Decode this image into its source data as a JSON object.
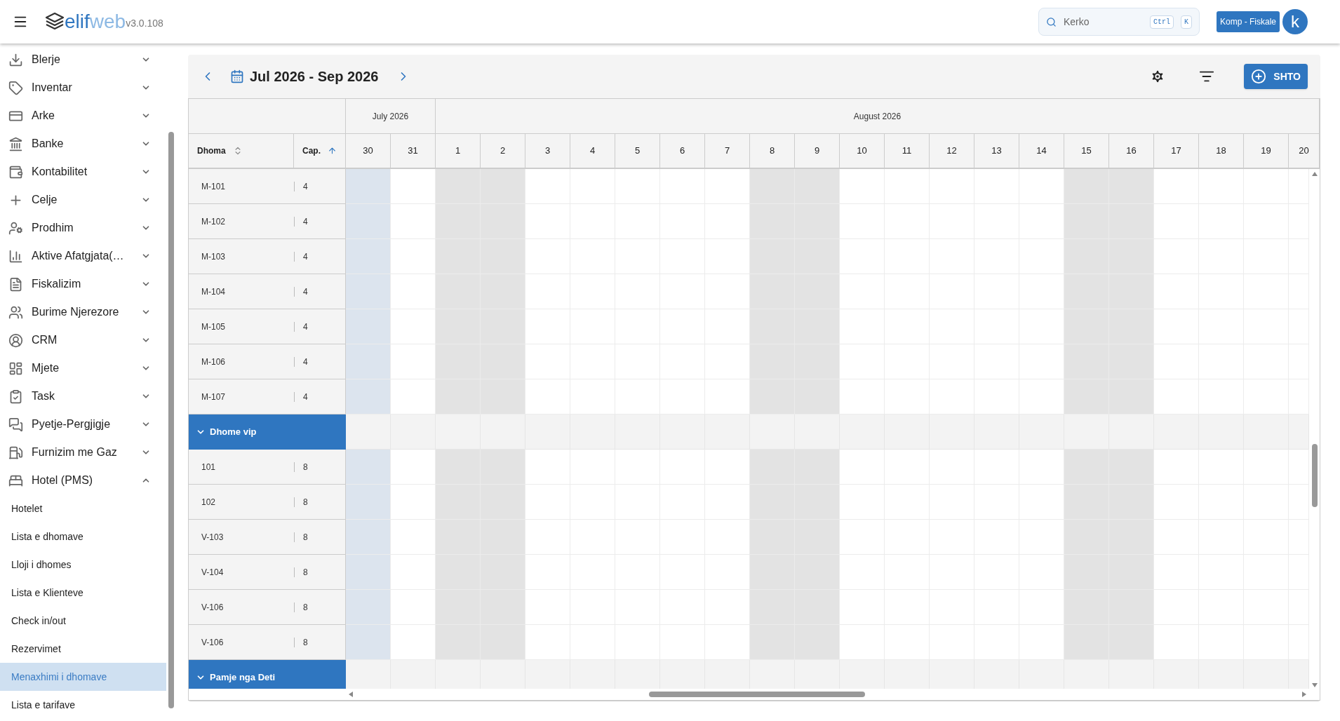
{
  "header": {
    "logo_strong": "elif",
    "logo_light": "web",
    "version": "v3.0.108",
    "search": {
      "placeholder": "Kerko",
      "keys": [
        "Ctrl",
        "K"
      ]
    },
    "company": "Komp - Fiskale",
    "avatar": "k"
  },
  "sidebar": {
    "items": [
      {
        "label": "Blerje",
        "expanded": false
      },
      {
        "label": "Inventar",
        "expanded": false
      },
      {
        "label": "Arke",
        "expanded": false
      },
      {
        "label": "Banke",
        "expanded": false
      },
      {
        "label": "Kontabilitet",
        "expanded": false
      },
      {
        "label": "Celje",
        "expanded": false
      },
      {
        "label": "Prodhim",
        "expanded": false
      },
      {
        "label": "Aktive Afatgjata(…",
        "expanded": false
      },
      {
        "label": "Fiskalizim",
        "expanded": false
      },
      {
        "label": "Burime Njerezore",
        "expanded": false
      },
      {
        "label": "CRM",
        "expanded": false
      },
      {
        "label": "Mjete",
        "expanded": false
      },
      {
        "label": "Task",
        "expanded": false
      },
      {
        "label": "Pyetje-Pergjigje",
        "expanded": false
      },
      {
        "label": "Furnizim me Gaz",
        "expanded": false
      },
      {
        "label": "Hotel (PMS)",
        "expanded": true,
        "children": [
          {
            "label": "Hotelet",
            "selected": false
          },
          {
            "label": "Lista e dhomave",
            "selected": false
          },
          {
            "label": "Lloji i dhomes",
            "selected": false
          },
          {
            "label": "Lista e Klienteve",
            "selected": false
          },
          {
            "label": "Check in/out",
            "selected": false
          },
          {
            "label": "Rezervimet",
            "selected": false
          },
          {
            "label": "Menaxhimi i dhomave",
            "selected": true
          },
          {
            "label": "Lista e tarifave",
            "selected": false
          }
        ]
      }
    ]
  },
  "scheduler": {
    "range": "Jul 2026 - Sep 2026",
    "add_button": "SHTO",
    "columns": [
      {
        "label": "Dhoma",
        "sorted": false
      },
      {
        "label": "Cap.",
        "sorted": true
      }
    ],
    "months": [
      {
        "label": "July 2026",
        "days": [
          {
            "label": "30",
            "weekend": false,
            "today": true
          },
          {
            "label": "31",
            "weekend": false,
            "today": false
          }
        ]
      },
      {
        "label": "August 2026",
        "days": [
          {
            "label": "1",
            "weekend": true,
            "today": false
          },
          {
            "label": "2",
            "weekend": true,
            "today": false
          },
          {
            "label": "3",
            "weekend": false,
            "today": false
          },
          {
            "label": "4",
            "weekend": false,
            "today": false
          },
          {
            "label": "5",
            "weekend": false,
            "today": false
          },
          {
            "label": "6",
            "weekend": false,
            "today": false
          },
          {
            "label": "7",
            "weekend": false,
            "today": false
          },
          {
            "label": "8",
            "weekend": true,
            "today": false
          },
          {
            "label": "9",
            "weekend": true,
            "today": false
          },
          {
            "label": "10",
            "weekend": false,
            "today": false
          },
          {
            "label": "11",
            "weekend": false,
            "today": false
          },
          {
            "label": "12",
            "weekend": false,
            "today": false
          },
          {
            "label": "13",
            "weekend": false,
            "today": false
          },
          {
            "label": "14",
            "weekend": false,
            "today": false
          },
          {
            "label": "15",
            "weekend": true,
            "today": false
          },
          {
            "label": "16",
            "weekend": true,
            "today": false
          },
          {
            "label": "17",
            "weekend": false,
            "today": false
          },
          {
            "label": "18",
            "weekend": false,
            "today": false
          },
          {
            "label": "19",
            "weekend": false,
            "today": false
          },
          {
            "label": "20",
            "weekend": false,
            "today": false
          }
        ]
      }
    ],
    "rows": [
      {
        "kind": "room",
        "name": "M-101",
        "capacity": "4"
      },
      {
        "kind": "room",
        "name": "M-102",
        "capacity": "4"
      },
      {
        "kind": "room",
        "name": "M-103",
        "capacity": "4"
      },
      {
        "kind": "room",
        "name": "M-104",
        "capacity": "4"
      },
      {
        "kind": "room",
        "name": "M-105",
        "capacity": "4"
      },
      {
        "kind": "room",
        "name": "M-106",
        "capacity": "4"
      },
      {
        "kind": "room",
        "name": "M-107",
        "capacity": "4"
      },
      {
        "kind": "group",
        "name": "Dhome vip",
        "expanded": true
      },
      {
        "kind": "room",
        "name": "101",
        "capacity": "8"
      },
      {
        "kind": "room",
        "name": "102",
        "capacity": "8"
      },
      {
        "kind": "room",
        "name": "V-103",
        "capacity": "8"
      },
      {
        "kind": "room",
        "name": "V-104",
        "capacity": "8"
      },
      {
        "kind": "room",
        "name": "V-106",
        "capacity": "8"
      },
      {
        "kind": "room",
        "name": "V-106",
        "capacity": "8"
      },
      {
        "kind": "group",
        "name": "Pamje nga Deti",
        "expanded": true
      }
    ]
  }
}
